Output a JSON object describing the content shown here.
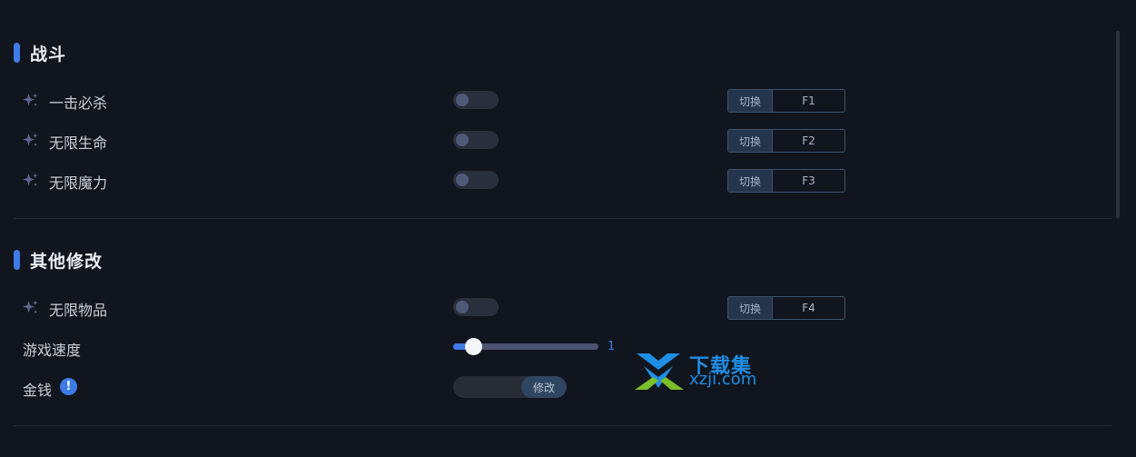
{
  "sections": [
    {
      "title": "战斗",
      "items": [
        {
          "label": "一击必杀",
          "icon": "sparkle-icon",
          "toggle_on": false,
          "action": "切换",
          "hotkey": "F1"
        },
        {
          "label": "无限生命",
          "icon": "sparkle-icon",
          "toggle_on": false,
          "action": "切换",
          "hotkey": "F2"
        },
        {
          "label": "无限魔力",
          "icon": "sparkle-icon",
          "toggle_on": false,
          "action": "切换",
          "hotkey": "F3"
        }
      ]
    },
    {
      "title": "其他修改",
      "items": [
        {
          "label": "无限物品",
          "icon": "sparkle-icon",
          "toggle_on": false,
          "action": "切换",
          "hotkey": "F4"
        }
      ],
      "speed": {
        "label": "游戏速度",
        "value": "1",
        "fraction": 0.1
      },
      "money": {
        "label": "金钱",
        "info_icon": "!",
        "input_value": "",
        "button_label": "修改"
      }
    }
  ],
  "watermark": {
    "top": "下载集",
    "bottom": "xzji.com"
  },
  "colors": {
    "accent": "#3e7be6",
    "background": "#11151d",
    "watermark": "#1f8ee6"
  }
}
